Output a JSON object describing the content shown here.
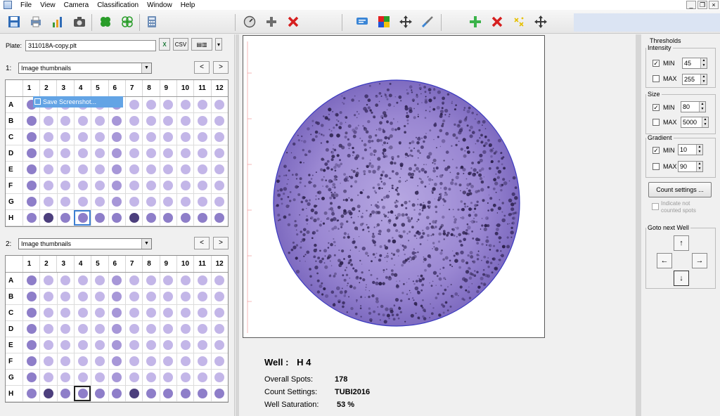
{
  "menu": [
    "File",
    "View",
    "Camera",
    "Classification",
    "Window",
    "Help"
  ],
  "toolbar_icons": [
    "save-icon",
    "print-icon",
    "bar-chart-icon",
    "camera-icon",
    "clover-icon",
    "clover-outline-icon",
    "calculator-icon",
    "dial-icon",
    "add-gray-icon",
    "delete-red-icon",
    "comment-icon",
    "color-palette-icon",
    "move-icon",
    "tools-icon",
    "add-green-icon",
    "delete-red-icon-2",
    "sparkle-icon",
    "move-icon-2"
  ],
  "plate": {
    "label": "Plate:",
    "file": "311018A-copy.plt",
    "csv_label": "CSV"
  },
  "panel1": {
    "index": "1:",
    "view": "Image thumbnails",
    "prev": "<",
    "next": ">"
  },
  "panel2": {
    "index": "2:",
    "view": "Image thumbnails",
    "prev": "<",
    "next": ">"
  },
  "columns": [
    "1",
    "2",
    "3",
    "4",
    "5",
    "6",
    "7",
    "8",
    "9",
    "10",
    "11",
    "12"
  ],
  "rows": [
    "A",
    "B",
    "C",
    "D",
    "E",
    "F",
    "G",
    "H"
  ],
  "selected_well": {
    "row": "H",
    "col": 4
  },
  "context_menu": {
    "item": "Save Screenshot..."
  },
  "well_info": {
    "title_label": "Well :",
    "title_value": "H 4",
    "overall_spots_label": "Overall Spots:",
    "overall_spots": "178",
    "count_settings_label": "Count Settings:",
    "count_settings": "TUBI2016",
    "saturation_label": "Well Saturation:",
    "saturation": "53 %"
  },
  "thresholds": {
    "title": "Thresholds",
    "intensity": {
      "label": "Intensity",
      "min_label": "MIN",
      "min": "45",
      "min_checked": true,
      "max_label": "MAX",
      "max": "255",
      "max_checked": false
    },
    "size": {
      "label": "Size",
      "min_label": "MIN",
      "min": "80",
      "min_checked": true,
      "max_label": "MAX",
      "max": "5000",
      "max_checked": false
    },
    "gradient": {
      "label": "Gradient",
      "min_label": "MIN",
      "min": "10",
      "min_checked": true,
      "max_label": "MAX",
      "max": "90",
      "max_checked": false
    },
    "count_settings_button": "Count settings ...",
    "indicate_not_counted": "Indicate not counted spots"
  },
  "goto_next": {
    "label": "Goto next Well",
    "up": "↑",
    "left": "←",
    "right": "→",
    "down": "↓"
  },
  "colors": {
    "well_light": "#c3b6e8",
    "well_mid": "#8e7ec9",
    "well_dark": "#4c3f7d",
    "selection": "#3d7fd2"
  }
}
